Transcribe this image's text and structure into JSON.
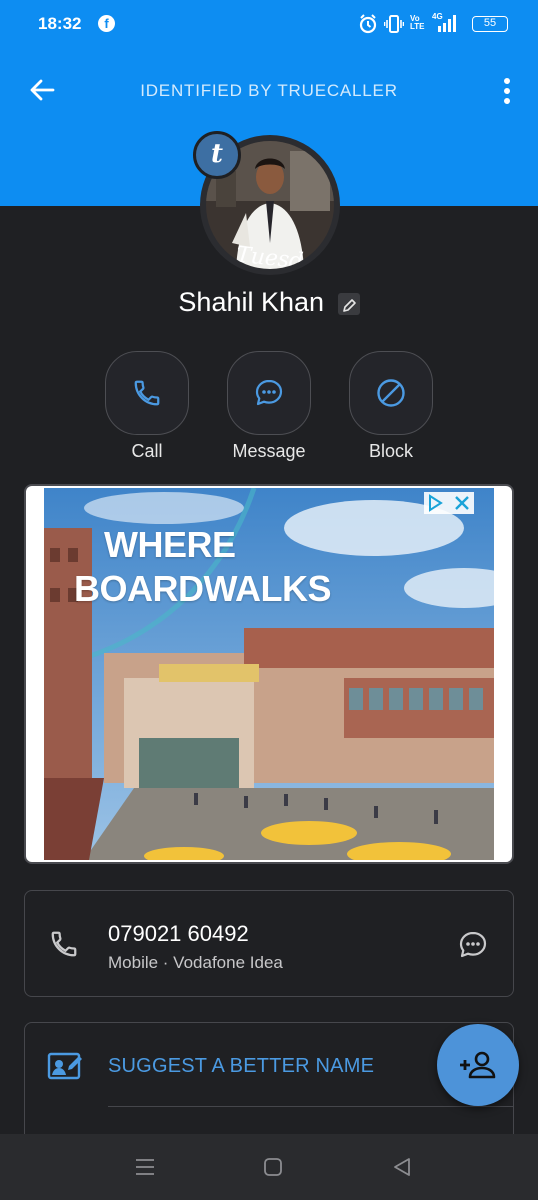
{
  "status_bar": {
    "time": "18:32",
    "notification_icon": "facebook-icon",
    "network_label_top": "Vo",
    "network_label_bottom": "LTE",
    "network_type": "4G",
    "battery": "55"
  },
  "app_bar": {
    "title": "IDENTIFIED BY TRUECALLER",
    "back_icon": "arrow-left-icon",
    "more_icon": "more-vertical-icon"
  },
  "profile": {
    "badge_letter": "t",
    "name": "Shahil Khan",
    "photo_caption": "Tuesda"
  },
  "actions": [
    {
      "label": "Call",
      "icon": "phone-icon"
    },
    {
      "label": "Message",
      "icon": "chat-bubble-icon"
    },
    {
      "label": "Block",
      "icon": "block-icon"
    }
  ],
  "ad": {
    "headline_line1": "WHERE",
    "headline_line2": "BOARDWALKS"
  },
  "phone": {
    "number": "079021 60492",
    "meta": "Mobile · Vodafone Idea"
  },
  "suggest": {
    "label": "SUGGEST A BETTER NAME"
  },
  "colors": {
    "header_blue": "#0d8df2",
    "background": "#1f2023",
    "accent_blue": "#4b9ae2",
    "fab": "#4d93d9"
  }
}
